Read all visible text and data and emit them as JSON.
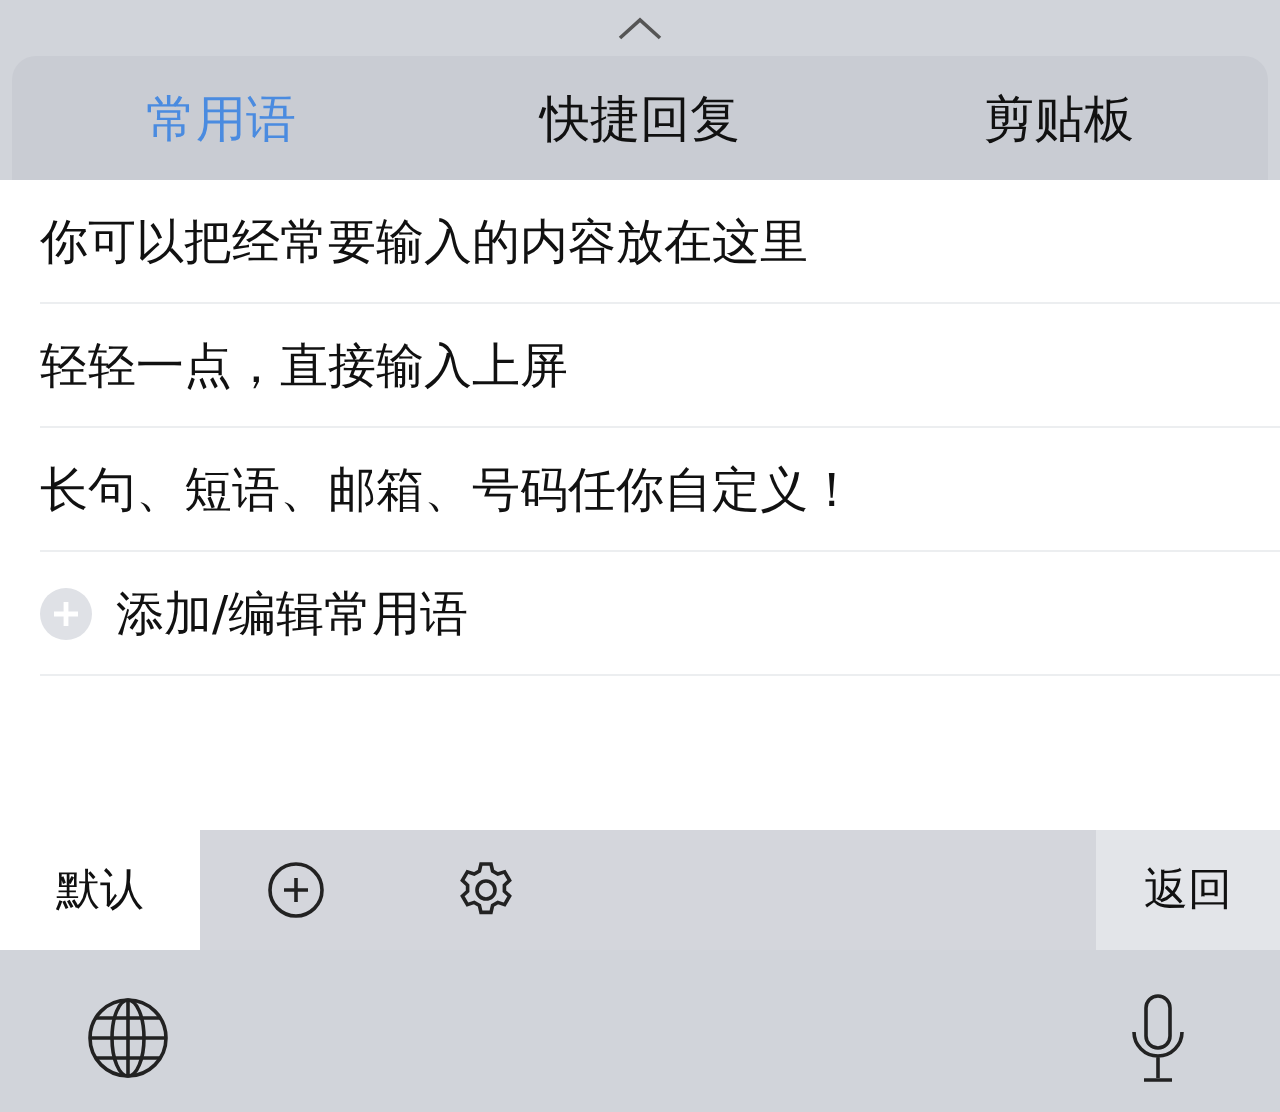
{
  "tabs": [
    {
      "label": "常用语",
      "selected": true
    },
    {
      "label": "快捷回复",
      "selected": false
    },
    {
      "label": "剪贴板",
      "selected": false
    }
  ],
  "phrases": [
    {
      "text": "你可以把经常要输入的内容放在这里",
      "kind": "phrase"
    },
    {
      "text": "轻轻一点，直接输入上屏",
      "kind": "phrase"
    },
    {
      "text": "长句、短语、邮箱、号码任你自定义！",
      "kind": "phrase"
    },
    {
      "text": "添加/编辑常用语",
      "kind": "add"
    }
  ],
  "toolbar": {
    "groups": [
      {
        "label": "默认",
        "selected": true
      }
    ],
    "back": "返回"
  }
}
